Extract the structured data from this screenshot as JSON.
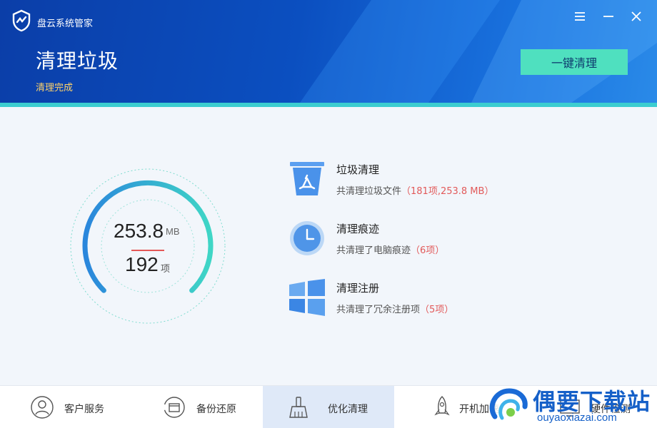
{
  "app": {
    "title": "盘云系统管家"
  },
  "window": {
    "menu_icon": "menu-icon",
    "minimize_icon": "minimize-icon",
    "close_icon": "close-icon"
  },
  "header": {
    "title": "清理垃圾",
    "status": "清理完成",
    "clean_button": "一键清理"
  },
  "gauge": {
    "size_value": "253.8",
    "size_unit": "MB",
    "count_value": "192",
    "count_unit": "项"
  },
  "results": [
    {
      "icon": "recycle-bin-icon",
      "title": "垃圾清理",
      "desc": "共清理垃圾文件",
      "detail": "（181项,253.8 MB）"
    },
    {
      "icon": "clock-icon",
      "title": "清理痕迹",
      "desc": "共清理了电脑痕迹",
      "detail": "（6项）"
    },
    {
      "icon": "windows-icon",
      "title": "清理注册",
      "desc": "共清理了冗余注册项",
      "detail": "（5项）"
    }
  ],
  "bottom_nav": [
    {
      "icon": "user-icon",
      "label": "客户服务"
    },
    {
      "icon": "backup-icon",
      "label": "备份还原"
    },
    {
      "icon": "broom-icon",
      "label": "优化清理",
      "active": true
    },
    {
      "icon": "rocket-icon",
      "label": "开机加速"
    },
    {
      "icon": "hardware-icon",
      "label": "硬件检测"
    }
  ],
  "watermark": {
    "title": "偶要下载站",
    "url": "ouyaoxiazai.com"
  },
  "colors": {
    "header_start": "#0b3ea8",
    "header_end": "#2a8ae8",
    "accent_teal": "#3ccdd0",
    "button": "#4fe0bf",
    "highlight_red": "#e25a5a",
    "status_yellow": "#ffd36a"
  }
}
